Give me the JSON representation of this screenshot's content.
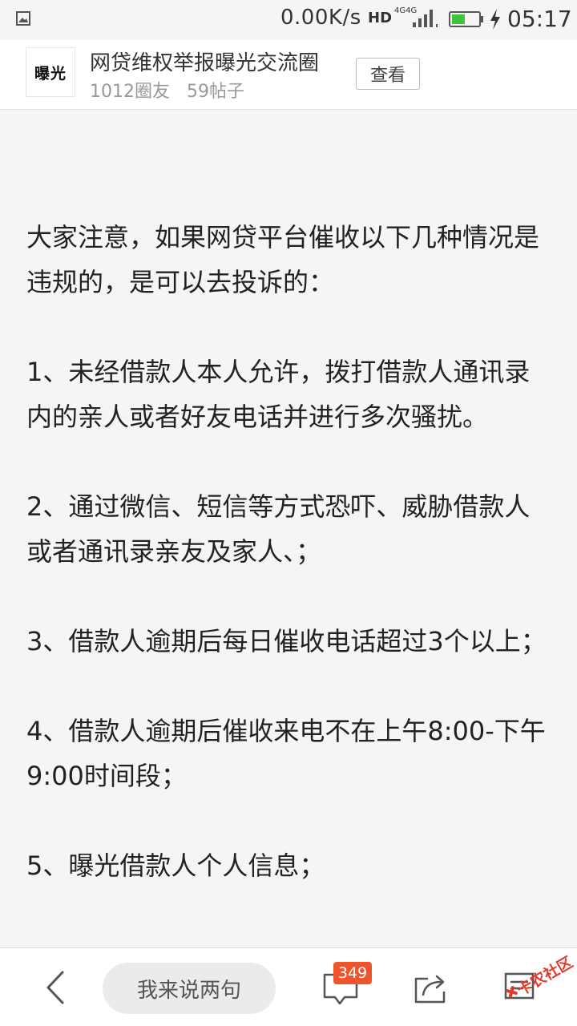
{
  "status_bar": {
    "network_speed": "0.00K/s",
    "hd_label": "HD",
    "network_type_1": "4G",
    "network_type_2": "4G",
    "time": "05:17"
  },
  "circle": {
    "logo_text": "曝光",
    "name": "网贷维权举报曝光交流圈",
    "members": "1012圈友",
    "posts": "59帖子",
    "view_label": "查看"
  },
  "post": {
    "paragraphs": [
      "大家注意，如果网贷平台催收以下几种情况是违规的，是可以去投诉的：",
      "1、未经借款人本人允许，拨打借款人通讯录内的亲人或者好友电话并进行多次骚扰。",
      "2、通过微信、短信等方式恐吓、威胁借款人或者通讯录亲友及家人、；",
      "3、借款人逾期后每日催收电话超过3个以上；",
      "4、借款人逾期后催收来电不在上午8:00-下午9:00时间段；",
      "5、曝光借款人个人信息；"
    ]
  },
  "bottom_bar": {
    "comment_placeholder": "我来说两句",
    "comment_count": "349",
    "watermark_text": "卡农社区"
  },
  "colors": {
    "badge": "#f0542c",
    "battery_fill": "#3cc43c",
    "text": "#222222",
    "muted": "#999999"
  }
}
